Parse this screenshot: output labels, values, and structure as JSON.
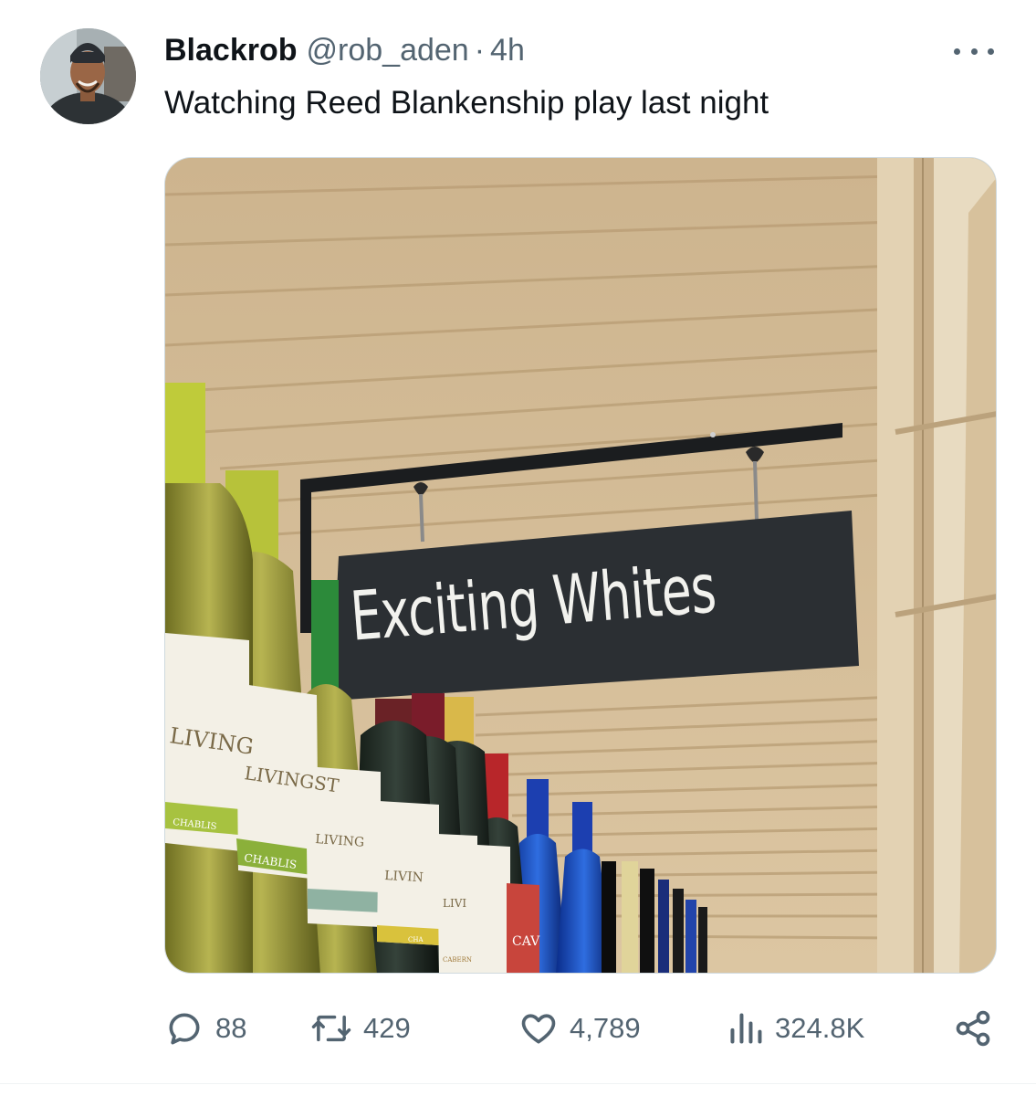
{
  "tweet": {
    "display_name": "Blackrob",
    "handle": "@rob_aden",
    "separator": "·",
    "time": "4h",
    "text": "Watching Reed Blankenship play last night",
    "more_icon": "more-horizontal-icon"
  },
  "media": {
    "sign_text": "Exciting Whites",
    "bottle_labels": [
      "LIVING",
      "LIVINGST",
      "CHABLIS",
      "CHABLIS",
      "LIVING",
      "LIVIN",
      "LIVI",
      "CHA",
      "CABERN",
      "CAV"
    ]
  },
  "actions": {
    "replies": {
      "icon": "reply-icon",
      "count": "88"
    },
    "retweets": {
      "icon": "retweet-icon",
      "count": "429"
    },
    "likes": {
      "icon": "heart-icon",
      "count": "4,789"
    },
    "views": {
      "icon": "views-chart-icon",
      "count": "324.8K"
    },
    "share": {
      "icon": "share-icon"
    }
  },
  "colors": {
    "text_primary": "#0f1419",
    "text_secondary": "#536471",
    "sign_background": "#2b2f33",
    "ceiling": "#d2b994"
  }
}
